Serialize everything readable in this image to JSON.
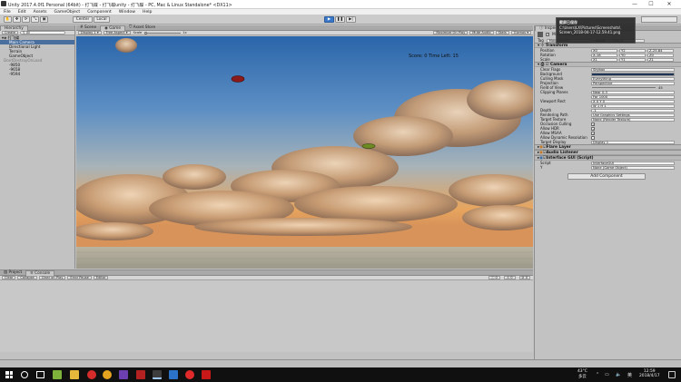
{
  "window": {
    "title": "Unity 2017.4.0f1 Personal (64bit) - 打飞碟 - 打飞碟unity - 打飞碟 - PC, Mac & Linux Standalone* <DX11>",
    "minimize": "—",
    "maximize": "☐",
    "close": "✕"
  },
  "menu": [
    "File",
    "Edit",
    "Assets",
    "GameObject",
    "Component",
    "Window",
    "Help"
  ],
  "toolbar": {
    "center_label": "Center",
    "local_label": "Local",
    "play_glyph": "▶",
    "pause_glyph": "❚❚",
    "step_glyph": "▶|"
  },
  "hierarchy": {
    "tab_label": "Hierarchy",
    "create_label": "Create",
    "search_placeholder": "All",
    "scene_name": "打飞碟",
    "items": [
      {
        "label": "Main Camera",
        "indent": 1,
        "state": "selected"
      },
      {
        "label": "Directional Light",
        "indent": 1,
        "state": "normal"
      },
      {
        "label": "Terrain",
        "indent": 1,
        "state": "normal"
      },
      {
        "label": "GameObject",
        "indent": 1,
        "state": "normal"
      },
      {
        "label": "DontDestroyOnLoad",
        "indent": 0,
        "state": "dim"
      },
      {
        "label": "-9850",
        "indent": 1,
        "state": "normal"
      },
      {
        "label": "-9658",
        "indent": 1,
        "state": "normal"
      },
      {
        "label": "-9594",
        "indent": 1,
        "state": "normal"
      }
    ]
  },
  "views": {
    "tabs": [
      "Scene",
      "Game",
      "Asset Store"
    ],
    "active_tab": "Game",
    "display_label": "Display 1",
    "aspect_label": "Free Aspect",
    "scale_label": "Scale",
    "scale_value": "1x",
    "right_buttons": [
      "Maximize On Play",
      "Mute Audio",
      "Stats",
      "Gizmos"
    ],
    "hud_text": "Score: 0  Time Left:  15"
  },
  "inspector": {
    "tab_label": "Inspector",
    "object_name": "Main Camera",
    "tag_label": "Tag",
    "tag_value": "MainCamera",
    "layer_label": "Layer",
    "layer_value": "Default",
    "transform": {
      "header": "Transform",
      "rows": [
        {
          "label": "Position",
          "x": "0",
          "y": "2",
          "z": "-25.84"
        },
        {
          "label": "Rotation",
          "x": "-18",
          "y": "0",
          "z": "0"
        },
        {
          "label": "Scale",
          "x": "1",
          "y": "1",
          "z": "1"
        }
      ]
    },
    "camera": {
      "header": "Camera",
      "rows": [
        {
          "label": "Clear Flags",
          "value": "Skybox"
        },
        {
          "label": "Background",
          "value": ""
        },
        {
          "label": "Culling Mask",
          "value": "Everything"
        },
        {
          "label": "Projection",
          "value": "Perspective"
        },
        {
          "label": "Field of View",
          "value": "45"
        },
        {
          "label": "Clipping Planes",
          "value": "Near  0.3"
        },
        {
          "label": "",
          "value": "Far   1000"
        },
        {
          "label": "Viewport Rect",
          "value": "X 0    Y 0"
        },
        {
          "label": "",
          "value": "W 1    H 1"
        },
        {
          "label": "Depth",
          "value": "-1"
        },
        {
          "label": "Rendering Path",
          "value": "Use Graphics Settings"
        },
        {
          "label": "Target Texture",
          "value": "None (Render Texture)"
        }
      ],
      "checks": [
        {
          "label": "Occlusion Culling",
          "checked": "✓"
        },
        {
          "label": "Allow HDR",
          "checked": "✓"
        },
        {
          "label": "Allow MSAA",
          "checked": "✓"
        },
        {
          "label": "Allow Dynamic Resolution",
          "checked": ""
        }
      ],
      "target_display_label": "Target Display",
      "target_display_value": "Display 1"
    },
    "components": [
      "Flare Layer",
      "Audio Listener",
      "Interface GUI (Script)"
    ],
    "script_rows": [
      {
        "label": "Script",
        "value": "InterfaceGUI"
      },
      {
        "label": "Y",
        "value": "None (Game Object)"
      }
    ],
    "add_component_label": "Add Component"
  },
  "tooltip": {
    "line1": "截屏已保存",
    "line2": "C:\\Users\\LX\\Pictures\\Screenshots\\",
    "line3": "Screen_2018-04-17-12.59.41.png"
  },
  "console": {
    "tabs": [
      "Project",
      "Console"
    ],
    "buttons": [
      "Clear",
      "Collapse",
      "Clear on Play",
      "Error Pause",
      "Editor"
    ],
    "counts": [
      "0",
      "0",
      "0"
    ]
  },
  "taskbar": {
    "weather": "43°C",
    "weather_desc": "多云",
    "ime": "英",
    "time": "12:59",
    "date": "2018/4/17"
  },
  "colors": {
    "selection": "#4a6f9e",
    "play_active": "#3a78c9",
    "sky_top": "#2f6db0",
    "horizon": "#e7a55e"
  }
}
